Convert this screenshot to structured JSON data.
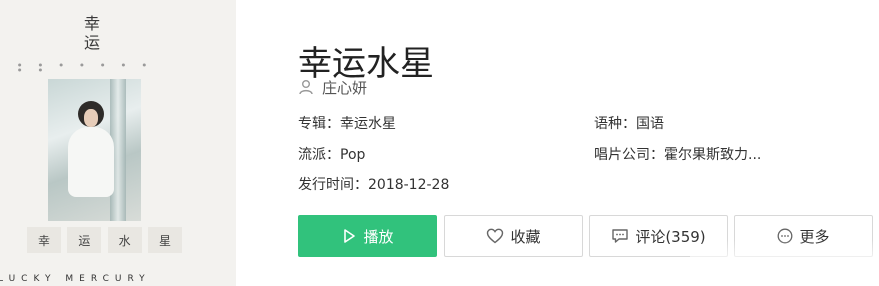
{
  "cover": {
    "calligraphy": "幸运",
    "title_chars": [
      "幸",
      "运",
      "水",
      "星"
    ],
    "english_title": "LUCKY MERCURY"
  },
  "song": {
    "title": "幸运水星",
    "artist": "庄心妍"
  },
  "meta": {
    "album": "专辑：幸运水星",
    "language": "语种：国语",
    "genre": "流派：Pop",
    "label": "唱片公司：霍尔果斯致力...",
    "release": "发行时间：2018-12-28"
  },
  "actions": {
    "play": "播放",
    "favorite": "收藏",
    "comment": "评论(359)",
    "more": "更多"
  },
  "colors": {
    "accent": "#31c27c"
  },
  "icons": [
    "user-icon",
    "play-icon",
    "heart-icon",
    "comment-icon",
    "more-icon"
  ]
}
